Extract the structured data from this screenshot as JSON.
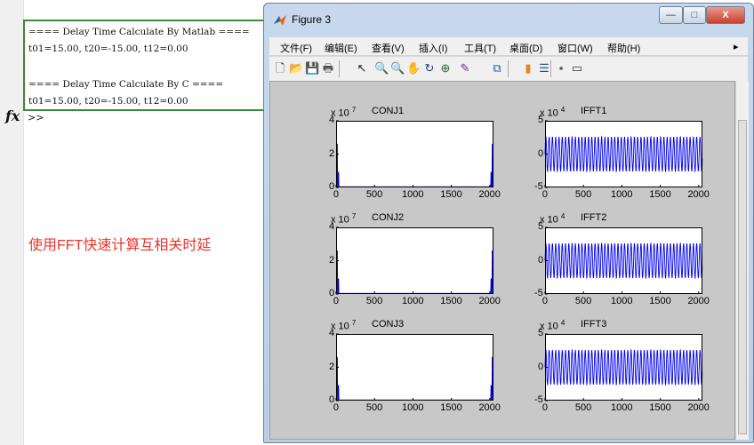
{
  "command_window": {
    "output_lines": [
      "==== Delay Time Calculate By Matlab ====",
      "t01=15.00, t20=-15.00, t12=0.00",
      "",
      "==== Delay Time Calculate By C ====",
      "t01=15.00, t20=-15.00, t12=0.00"
    ],
    "fx_label": "fx",
    "prompt": ">>"
  },
  "annotation": "使用FFT快速计算互相关时延",
  "annotation_color": "#e8352d",
  "highlight_color": "#3a8a3a",
  "figure": {
    "title": "Figure 3",
    "window_buttons": [
      "—",
      "□",
      "X"
    ],
    "menu": [
      "文件(F)",
      "编辑(E)",
      "查看(V)",
      "插入(I)",
      "工具(T)",
      "桌面(D)",
      "窗口(W)",
      "帮助(H)"
    ],
    "menu_arrow": "▸",
    "toolbar_icons": [
      "new-figure-icon",
      "open-file-icon",
      "save-icon",
      "print-icon",
      "edit-plot-pointer-icon",
      "zoom-in-icon",
      "zoom-out-icon",
      "pan-hand-icon",
      "rotate-3d-icon",
      "data-cursor-icon",
      "brush-icon",
      "link-plot-icon",
      "colorbar-icon",
      "legend-icon",
      "hide-plot-tools-icon",
      "show-plot-tools-icon"
    ],
    "toolbar_glyphs": [
      "🗋",
      "📂",
      "💾",
      "🖶",
      "↖",
      "🔍",
      "🔍",
      "✋",
      "↻",
      "⊕",
      "✎",
      "⧉",
      "▮",
      "☰",
      "▪",
      "▭"
    ]
  },
  "chart_data": [
    {
      "type": "line",
      "title": "CONJ1",
      "exponent": "x 10",
      "exponent_power": "7",
      "ylim": [
        0,
        4
      ],
      "yticks": [
        "0",
        "2",
        "4"
      ],
      "xlim": [
        0,
        2048
      ],
      "xticks": [
        "0",
        "500",
        "1000",
        "1500",
        "2000"
      ],
      "series": [
        {
          "color": "#0000ee",
          "description": "mostly zero, spike ~2.6 at x≈15 and x≈2033",
          "peak": 2.6
        }
      ]
    },
    {
      "type": "line",
      "title": "IFFT1",
      "exponent": "x 10",
      "exponent_power": "4",
      "ylim": [
        -5,
        5
      ],
      "yticks": [
        "-5",
        "0",
        "5"
      ],
      "xlim": [
        0,
        2048
      ],
      "xticks": [
        "0",
        "500",
        "1000",
        "1500",
        "2000"
      ],
      "series": [
        {
          "color": "#0000ee",
          "amplitude": 2.6,
          "cycles": 48
        }
      ]
    },
    {
      "type": "line",
      "title": "CONJ2",
      "exponent": "x 10",
      "exponent_power": "7",
      "ylim": [
        0,
        4
      ],
      "yticks": [
        "0",
        "2",
        "4"
      ],
      "xlim": [
        0,
        2048
      ],
      "xticks": [
        "0",
        "500",
        "1000",
        "1500",
        "2000"
      ],
      "series": [
        {
          "color": "#0000ee",
          "peak": 2.6
        }
      ]
    },
    {
      "type": "line",
      "title": "IFFT2",
      "exponent": "x 10",
      "exponent_power": "4",
      "ylim": [
        -5,
        5
      ],
      "yticks": [
        "-5",
        "0",
        "5"
      ],
      "xlim": [
        0,
        2048
      ],
      "xticks": [
        "0",
        "500",
        "1000",
        "1500",
        "2000"
      ],
      "series": [
        {
          "color": "#0000ee",
          "amplitude": 2.6,
          "cycles": 48
        }
      ]
    },
    {
      "type": "line",
      "title": "CONJ3",
      "exponent": "x 10",
      "exponent_power": "7",
      "ylim": [
        0,
        4
      ],
      "yticks": [
        "0",
        "2",
        "4"
      ],
      "xlim": [
        0,
        2048
      ],
      "xticks": [
        "0",
        "500",
        "1000",
        "1500",
        "2000"
      ],
      "series": [
        {
          "color": "#0000ee",
          "peak": 2.6
        }
      ]
    },
    {
      "type": "line",
      "title": "IFFT3",
      "exponent": "x 10",
      "exponent_power": "4",
      "ylim": [
        -5,
        5
      ],
      "yticks": [
        "-5",
        "0",
        "5"
      ],
      "xlim": [
        0,
        2048
      ],
      "xticks": [
        "0",
        "500",
        "1000",
        "1500",
        "2000"
      ],
      "series": [
        {
          "color": "#0000ee",
          "amplitude": 2.6,
          "cycles": 48
        }
      ]
    }
  ]
}
